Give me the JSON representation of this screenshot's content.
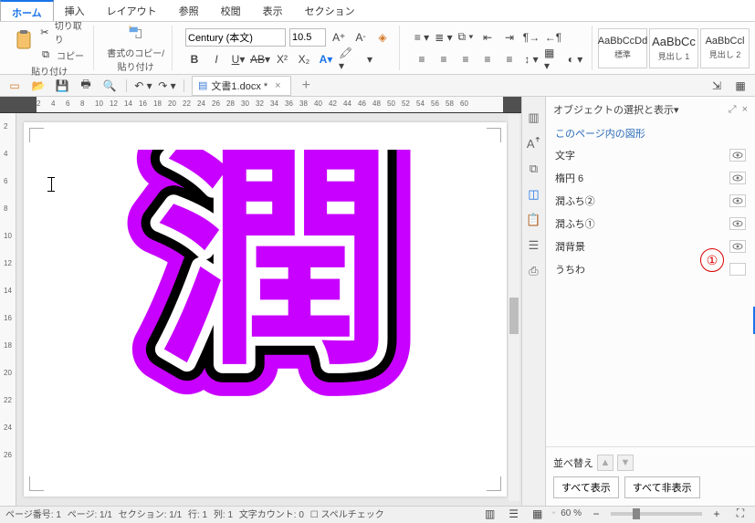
{
  "tabs": [
    "ホーム",
    "挿入",
    "レイアウト",
    "参照",
    "校閲",
    "表示",
    "セクション"
  ],
  "active_tab": 0,
  "ribbon": {
    "paste_label": "貼り付け",
    "cut_label": "切り取り",
    "copy_label": "コピー",
    "format_painter_label": "書式のコピー/\n貼り付け",
    "font_name": "Century (本文)",
    "font_size": "10.5",
    "styles": [
      {
        "preview": "AaBbCcDd",
        "label": "標準"
      },
      {
        "preview": "AaBbCc",
        "label": "見出し 1"
      },
      {
        "preview": "AaBbCcl",
        "label": "見出し 2"
      }
    ]
  },
  "quick_icons": [
    "new",
    "open",
    "save",
    "print",
    "print-preview",
    "undo",
    "redo"
  ],
  "doc_tab": {
    "icon": "doc-icon",
    "name": "文書1.docx *"
  },
  "ruler_h": [
    2,
    4,
    6,
    8,
    10,
    12,
    14,
    16,
    18,
    20,
    22,
    24,
    26,
    28,
    30,
    32,
    34,
    36,
    38,
    40,
    42,
    44,
    46,
    48,
    50,
    52,
    54,
    56,
    58,
    60
  ],
  "ruler_v": [
    2,
    4,
    6,
    8,
    10,
    12,
    14,
    16,
    18,
    20,
    22,
    24,
    26
  ],
  "big_char": "潤",
  "side_tools": [
    "properties",
    "styles",
    "paragraph",
    "columns",
    "selection",
    "clipboard",
    "outline"
  ],
  "panel": {
    "title": "オブジェクトの選択と表示",
    "subtitle": "このページ内の図形",
    "objects": [
      {
        "name": "文字",
        "visible": true
      },
      {
        "name": "楕円 6",
        "visible": true
      },
      {
        "name": "潤ふち②",
        "visible": true
      },
      {
        "name": "潤ふち①",
        "visible": true
      },
      {
        "name": "潤背景",
        "visible": true
      },
      {
        "name": "うちわ",
        "visible": false
      }
    ],
    "sort_label": "並べ替え",
    "show_all": "すべて表示",
    "hide_all": "すべて非表示"
  },
  "annotation": "①",
  "status": {
    "page_num": "ページ番号: 1",
    "page": "ページ: 1/1",
    "section": "セクション: 1/1",
    "line": "行: 1",
    "col": "列: 1",
    "chars": "文字カウント: 0",
    "spell": "スペルチェック",
    "zoom": "60 %"
  }
}
